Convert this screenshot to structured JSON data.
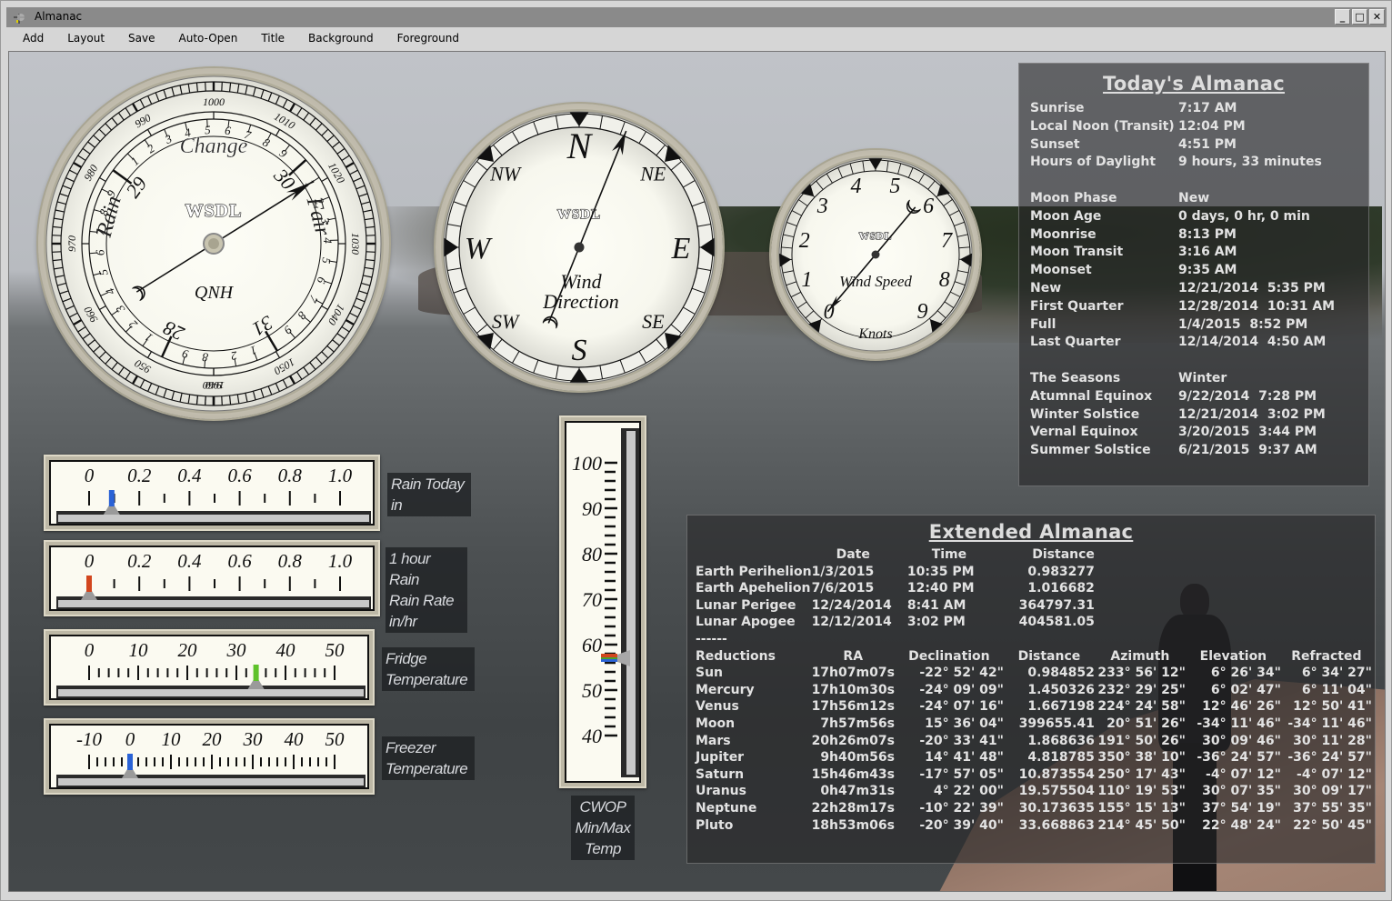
{
  "window": {
    "title": "Almanac",
    "controls": [
      "_",
      "□",
      "✕"
    ]
  },
  "menu": [
    "Add",
    "Layout",
    "Save",
    "Auto-Open",
    "Title",
    "Background",
    "Foreground"
  ],
  "barometer": {
    "brand": "WSDL",
    "labels": {
      "top": "Change",
      "left": "Rain",
      "right": "Fair",
      "bottom": "QNH"
    },
    "hpa_ticks": [
      "940",
      "950",
      "960",
      "970",
      "980",
      "990",
      "1000",
      "1010",
      "1020",
      "1030",
      "1040",
      "1050",
      "1060"
    ],
    "inhg_ticks": [
      "28",
      "29",
      "30",
      "31"
    ],
    "value_inhg": 30.1,
    "value_hpa": 1019
  },
  "wind_direction": {
    "brand": "WSDL",
    "title_line1": "Wind",
    "title_line2": "Direction",
    "cardinals": [
      "N",
      "NE",
      "E",
      "SE",
      "S",
      "SW",
      "W",
      "NW"
    ],
    "value_degrees": 22
  },
  "wind_speed": {
    "brand": "WSDL",
    "title": "Wind Speed",
    "unit": "Knots",
    "ticks": [
      "0",
      "1",
      "2",
      "3",
      "4",
      "5",
      "6",
      "7",
      "8",
      "9"
    ],
    "value": 0
  },
  "linear_gauges": [
    {
      "id": "rain-today",
      "ticks": [
        "0",
        "0.2",
        "0.4",
        "0.6",
        "0.8",
        "1.0"
      ],
      "min": 0,
      "max": 1.0,
      "minor": 0.1,
      "value": 0.09,
      "marker_color": "#2a62d6",
      "label": [
        "Rain Today",
        "in"
      ]
    },
    {
      "id": "rain-rate",
      "ticks": [
        "0",
        "0.2",
        "0.4",
        "0.6",
        "0.8",
        "1.0"
      ],
      "min": 0,
      "max": 1.0,
      "minor": 0.1,
      "value": 0.0,
      "marker_color": "#d2461e",
      "label": [
        "1 hour Rain",
        "Rain Rate",
        "in/hr"
      ]
    },
    {
      "id": "fridge-temp",
      "ticks": [
        "0",
        "10",
        "20",
        "30",
        "40",
        "50"
      ],
      "min": 0,
      "max": 50,
      "minor": 2,
      "value": 34,
      "marker_color": "#5ec22a",
      "label": [
        "Fridge",
        "Temperature"
      ]
    },
    {
      "id": "freezer-temp",
      "ticks": [
        "-10",
        "0",
        "10",
        "20",
        "30",
        "40",
        "50"
      ],
      "min": -10,
      "max": 50,
      "minor": 2,
      "value": 0,
      "marker_color": "#2a62d6",
      "label": [
        "Freezer",
        "Temperature"
      ]
    }
  ],
  "thermometer": {
    "ticks": [
      "100",
      "90",
      "80",
      "70",
      "60",
      "50",
      "40"
    ],
    "min": 40,
    "max": 100,
    "value": 57,
    "label": [
      "CWOP",
      "Min/Max",
      "Temp"
    ]
  },
  "today": {
    "title": "Today's Almanac",
    "sun": [
      [
        "Sunrise",
        "7:17 AM"
      ],
      [
        "Local Noon (Transit)",
        "12:04 PM"
      ],
      [
        "Sunset",
        "4:51 PM"
      ],
      [
        "Hours of Daylight",
        "9 hours, 33 minutes"
      ]
    ],
    "moon": [
      [
        "Moon Phase",
        "New"
      ],
      [
        "Moon Age",
        "0 days, 0 hr, 0 min"
      ],
      [
        "Moonrise",
        "8:13 PM"
      ],
      [
        "Moon Transit",
        "3:16 AM"
      ],
      [
        "Moonset",
        "9:35 AM"
      ],
      [
        "New",
        "12/21/2014  5:35 PM"
      ],
      [
        "First Quarter",
        "12/28/2014  10:31 AM"
      ],
      [
        "Full",
        "1/4/2015  8:52 PM"
      ],
      [
        "Last Quarter",
        "12/14/2014  4:50 AM"
      ]
    ],
    "seasons": [
      [
        "The Seasons",
        "Winter"
      ],
      [
        "Atumnal Equinox",
        "9/22/2014  7:28 PM"
      ],
      [
        "Winter Solstice",
        "12/21/2014  3:02 PM"
      ],
      [
        "Vernal Equinox",
        "3/20/2015  3:44 PM"
      ],
      [
        "Summer Solstice",
        "6/21/2015  9:37 AM"
      ]
    ]
  },
  "extended": {
    "title": "Extended Almanac",
    "events_header": [
      "",
      "Date",
      "Time",
      "Distance"
    ],
    "events": [
      [
        "Earth Perihelion",
        "1/3/2015",
        "10:35 PM",
        "0.983277"
      ],
      [
        "Earth Apehelion",
        "7/6/2015",
        "12:40 PM",
        "1.016682"
      ],
      [
        "Lunar Perigee",
        "12/24/2014",
        "8:41 AM",
        "364797.31"
      ],
      [
        "Lunar Apogee",
        "12/12/2014",
        "3:02 PM",
        "404581.05"
      ]
    ],
    "separator": "------",
    "reductions_header": [
      "Reductions",
      "RA",
      "Declination",
      "Distance",
      "Azimuth",
      "Elevation",
      "Refracted"
    ],
    "reductions": [
      [
        "Sun",
        "17h07m07s",
        "-22° 52' 42\"",
        "0.984852",
        "233° 56' 12\"",
        "6° 26' 34\"",
        "6° 34' 27\""
      ],
      [
        "Mercury",
        "17h10m30s",
        "-24° 09' 09\"",
        "1.450326",
        "232° 29' 25\"",
        "6° 02' 47\"",
        "6° 11' 04\""
      ],
      [
        "Venus",
        "17h56m12s",
        "-24° 07' 16\"",
        "1.667198",
        "224° 24' 58\"",
        "12° 46' 26\"",
        "12° 50' 41\""
      ],
      [
        "Moon",
        "7h57m56s",
        "15° 36' 04\"",
        "399655.41",
        "20° 51' 26\"",
        "-34° 11' 46\"",
        "-34° 11' 46\""
      ],
      [
        "Mars",
        "20h26m07s",
        "-20° 33' 41\"",
        "1.868636",
        "191° 50' 26\"",
        "30° 09' 46\"",
        "30° 11' 28\""
      ],
      [
        "Jupiter",
        "9h40m56s",
        "14° 41' 48\"",
        "4.818785",
        "350° 38' 10\"",
        "-36° 24' 57\"",
        "-36° 24' 57\""
      ],
      [
        "Saturn",
        "15h46m43s",
        "-17° 57' 05\"",
        "10.873554",
        "250° 17' 43\"",
        "-4° 07' 12\"",
        "-4° 07' 12\""
      ],
      [
        "Uranus",
        "0h47m31s",
        "4° 22' 00\"",
        "19.575504",
        "110° 19' 53\"",
        "30° 07' 35\"",
        "30° 09' 17\""
      ],
      [
        "Neptune",
        "22h28m17s",
        "-10° 22' 39\"",
        "30.173635",
        "155° 15' 13\"",
        "37° 54' 19\"",
        "37° 55' 35\""
      ],
      [
        "Pluto",
        "18h53m06s",
        "-20° 39' 40\"",
        "33.668863",
        "214° 45' 50\"",
        "22° 48' 24\"",
        "22° 50' 45\""
      ]
    ]
  }
}
